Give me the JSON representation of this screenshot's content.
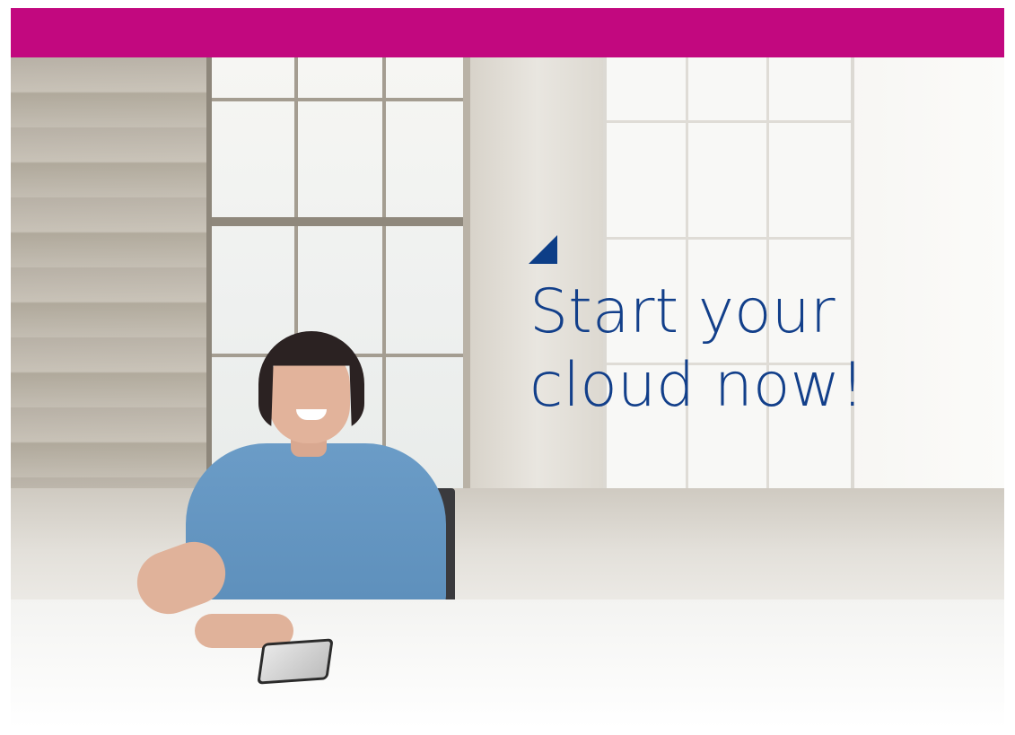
{
  "headline": {
    "line1": "Start your",
    "line2": "cloud now!"
  },
  "colors": {
    "top_bar": "#c2087f",
    "headline": "#123f8a",
    "triangle_accent": "#0d3e87"
  },
  "photo": {
    "description_icon": "woman-at-desk-photo"
  }
}
